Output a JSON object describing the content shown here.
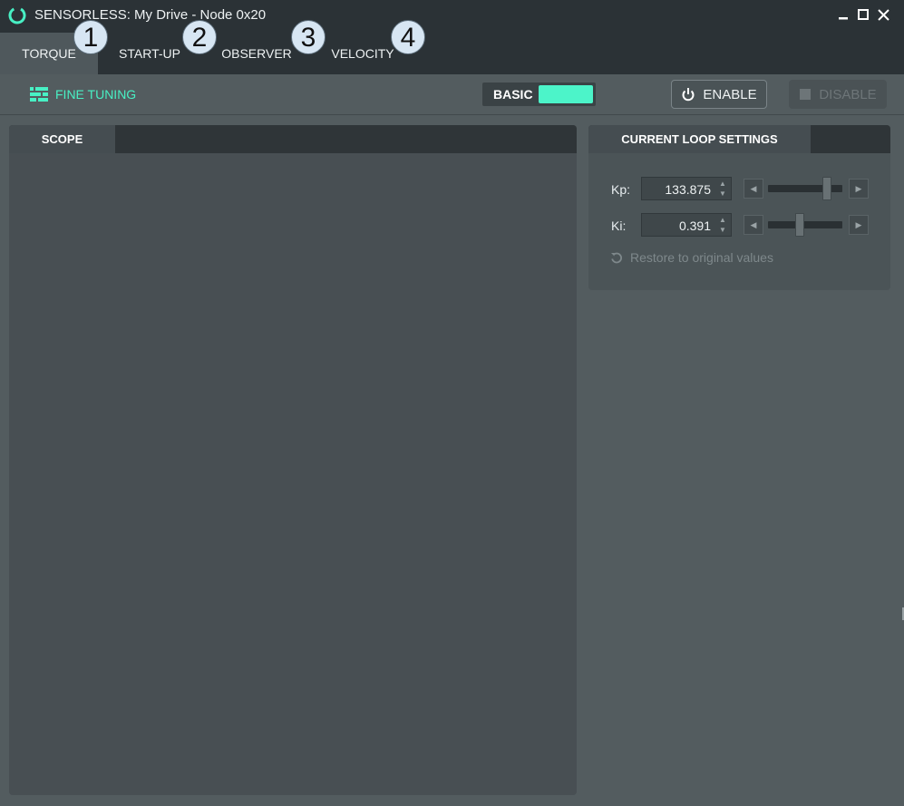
{
  "window": {
    "title": "SENSORLESS: My Drive - Node 0x20",
    "app_icon": "power-ring-icon",
    "controls": [
      "minimize-icon",
      "maximize-icon",
      "close-icon"
    ]
  },
  "tabs": [
    {
      "label": "TORQUE",
      "active": true
    },
    {
      "label": "START-UP",
      "active": false
    },
    {
      "label": "OBSERVER",
      "active": false
    },
    {
      "label": "VELOCITY",
      "active": false
    }
  ],
  "badges": [
    "1",
    "2",
    "3",
    "4"
  ],
  "toolbar": {
    "fine_tuning_label": "FINE TUNING",
    "fine_tuning_icon": "sliders-icon",
    "mode_label": "BASIC",
    "enable_label": "ENABLE",
    "enable_icon": "power-icon",
    "disable_label": "DISABLE",
    "disable_icon": "stop-icon"
  },
  "scope": {
    "tab_label": "SCOPE"
  },
  "current_loop": {
    "tab_label": "CURRENT LOOP SETTINGS",
    "kp_label": "Kp:",
    "kp_value": "133.875",
    "kp_slider_fraction": 0.84,
    "ki_label": "Ki:",
    "ki_value": "0.391",
    "ki_slider_fraction": 0.42,
    "restore_label": "Restore to original values",
    "restore_icon": "undo-icon"
  },
  "colors": {
    "accent": "#48f0c4",
    "titlebar": "#2b3236",
    "background": "#535c5f"
  }
}
